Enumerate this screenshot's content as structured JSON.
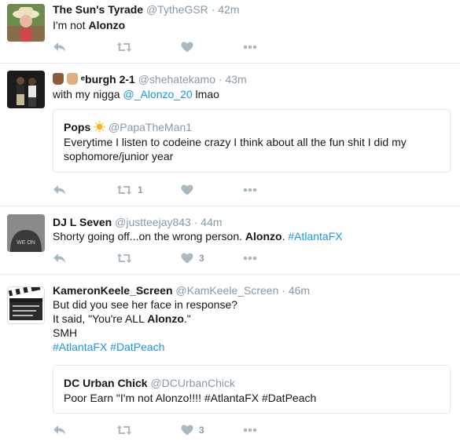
{
  "tweets": [
    {
      "name": "The Sun's Tyrade",
      "handle": "@TytheGSR",
      "sep": "·",
      "time": "42m",
      "text_plain": "I'm not ",
      "text_bold": "Alonzo",
      "actions": {
        "reply_icon": "reply-icon",
        "retweet_icon": "retweet-icon",
        "like_icon": "heart-icon",
        "more_icon": "more-icon"
      }
    },
    {
      "name_prefix": "ᵉburgh 2-1",
      "name": "ᵉburgh 2-1",
      "handle": "@shehatekamo",
      "sep": "·",
      "time": "43m",
      "text_plain": "with my nigga ",
      "mention": "@_Alonzo_20",
      "text_after": " lmao",
      "quote": {
        "name": "Pops",
        "handle": "@PapaTheMan1",
        "text": "Everytime I listen to codeine crazy I think about all the fun shit I did my sophomore/junior year"
      },
      "retweet_count": "1"
    },
    {
      "name": "DJ L Seven",
      "handle": "@justteejay843",
      "sep": "·",
      "time": "44m",
      "text_plain": "Shorty going off...on the wrong person. ",
      "text_bold": "Alonzo",
      "text_dot": ". ",
      "hashtag": "#AtlantaFX",
      "like_count": "3"
    },
    {
      "name": "KameronKeele_Screen",
      "handle": "@KamKeele_Screen",
      "sep": "·",
      "time": "46m",
      "line1": "But did you see her face in response?",
      "line2_plain": "It said, \"You're ALL ",
      "line2_bold": "Alonzo",
      "line2_end": ".\"",
      "line3": "SMH",
      "hashtag1": "#AtlantaFX",
      "hashtag2": "#DatPeach",
      "quote": {
        "name": "DC Urban Chick",
        "handle": "@DCUrbanChick",
        "text": "Poor Earn \"I'm not Alonzo!!!! #AtlantaFX #DatPeach"
      },
      "like_count": "3"
    }
  ],
  "colors": {
    "name": "#14171a",
    "muted": "#8899a6",
    "link": "#1b95e0",
    "border": "#e6ecf0"
  }
}
